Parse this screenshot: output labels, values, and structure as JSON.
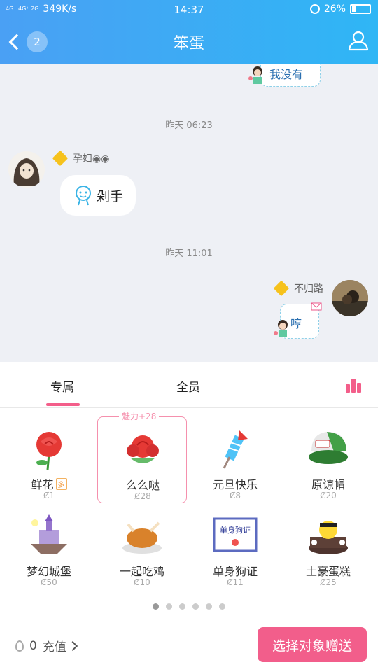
{
  "status": {
    "network": "4G⁺ 4G⁺ 2G",
    "speed": "349K/s",
    "time": "14:37",
    "battery": "26%"
  },
  "header": {
    "back_count": "2",
    "title": "笨蛋"
  },
  "chat": {
    "top_sticker_text": "我没有",
    "time1": "昨天 06:23",
    "msg1": {
      "nickname": "孕妇◉◉",
      "text": "剁手"
    },
    "time2": "昨天 11:01",
    "msg2": {
      "nickname": "不归路",
      "sticker_text": "哼"
    }
  },
  "panel": {
    "tabs": [
      {
        "label": "专属"
      },
      {
        "label": "全员"
      }
    ],
    "charm_label": "魅力+28",
    "tag_label": "多",
    "gifts": [
      {
        "name": "鲜花",
        "price": "1"
      },
      {
        "name": "么么哒",
        "price": "28"
      },
      {
        "name": "元旦快乐",
        "price": "8"
      },
      {
        "name": "原谅帽",
        "price": "20"
      },
      {
        "name": "梦幻城堡",
        "price": "50"
      },
      {
        "name": "一起吃鸡",
        "price": "10"
      },
      {
        "name": "单身狗证",
        "price": "11"
      },
      {
        "name": "土豪蛋糕",
        "price": "25"
      }
    ],
    "balance": "0",
    "recharge_label": "充值",
    "send_label": "选择对象赠送",
    "dog_cert_text": "单身狗证"
  },
  "colors": {
    "accent": "#f25e8b",
    "header": "#3aa9f5"
  }
}
